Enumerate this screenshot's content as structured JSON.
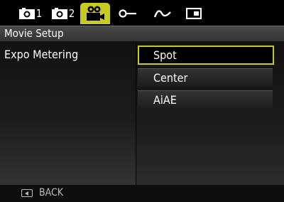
{
  "tabs": [
    {
      "icon": "camera-icon",
      "num": "1",
      "active": false
    },
    {
      "icon": "camera-icon",
      "num": "2",
      "active": false
    },
    {
      "icon": "movie-icon",
      "num": "",
      "active": true
    },
    {
      "icon": "key-icon",
      "num": "",
      "active": false
    },
    {
      "icon": "wave-icon",
      "num": "",
      "active": false
    },
    {
      "icon": "playback-icon",
      "num": "",
      "active": false
    }
  ],
  "header": {
    "title": "Movie Setup"
  },
  "setting": {
    "label": "Expo Metering"
  },
  "options": [
    {
      "label": "Spot",
      "selected": true
    },
    {
      "label": "Center",
      "selected": false
    },
    {
      "label": "AiAE",
      "selected": false
    }
  ],
  "footer": {
    "back_label": "BACK",
    "back_icon": "back-button-icon"
  },
  "colors": {
    "accent": "#c8cc1e",
    "background": "#000000",
    "text": "#ffffff"
  }
}
